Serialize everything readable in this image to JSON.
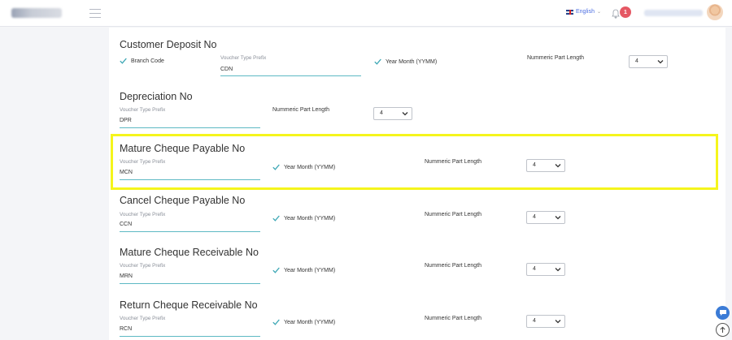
{
  "header": {
    "language": "English",
    "notification_count": "1"
  },
  "sections": [
    {
      "title": "Customer Deposit No",
      "branch_code_label": "Branch Code",
      "prefix_label": "Voucher Type Prefix",
      "prefix_value": "CDN",
      "year_month_label": "Year Month (YYMM)",
      "length_label": "Nummeric Part Length",
      "length_value": "4"
    },
    {
      "title": "Depreciation No",
      "prefix_label": "Voucher Type Prefix",
      "prefix_value": "DPR",
      "length_label": "Nummeric Part Length",
      "length_value": "4"
    },
    {
      "title": "Mature Cheque Payable No",
      "prefix_label": "Voucher Type Prefix",
      "prefix_value": "MCN",
      "year_month_label": "Year Month (YYMM)",
      "length_label": "Nummeric Part Length",
      "length_value": "4"
    },
    {
      "title": "Cancel Cheque Payable No",
      "prefix_label": "Voucher Type Prefix",
      "prefix_value": "CCN",
      "year_month_label": "Year Month (YYMM)",
      "length_label": "Nummeric Part Length",
      "length_value": "4"
    },
    {
      "title": "Mature Cheque Receivable No",
      "prefix_label": "Voucher Type Prefix",
      "prefix_value": "MRN",
      "year_month_label": "Year Month (YYMM)",
      "length_label": "Nummeric Part Length",
      "length_value": "4"
    },
    {
      "title": "Return Cheque Receivable No",
      "prefix_label": "Voucher Type Prefix",
      "prefix_value": "RCN",
      "year_month_label": "Year Month (YYMM)",
      "length_label": "Nummeric Part Length",
      "length_value": "4"
    }
  ],
  "colors": {
    "accent_underline": "#5db9c4",
    "check": "#3aa6b4",
    "highlight": "#f5f51c",
    "badge": "#e55864"
  },
  "icons": {
    "menu": "hamburger-icon",
    "bell": "bell-icon",
    "check": "check-icon",
    "chat": "chat-icon",
    "scroll_up": "arrow-up-icon"
  }
}
